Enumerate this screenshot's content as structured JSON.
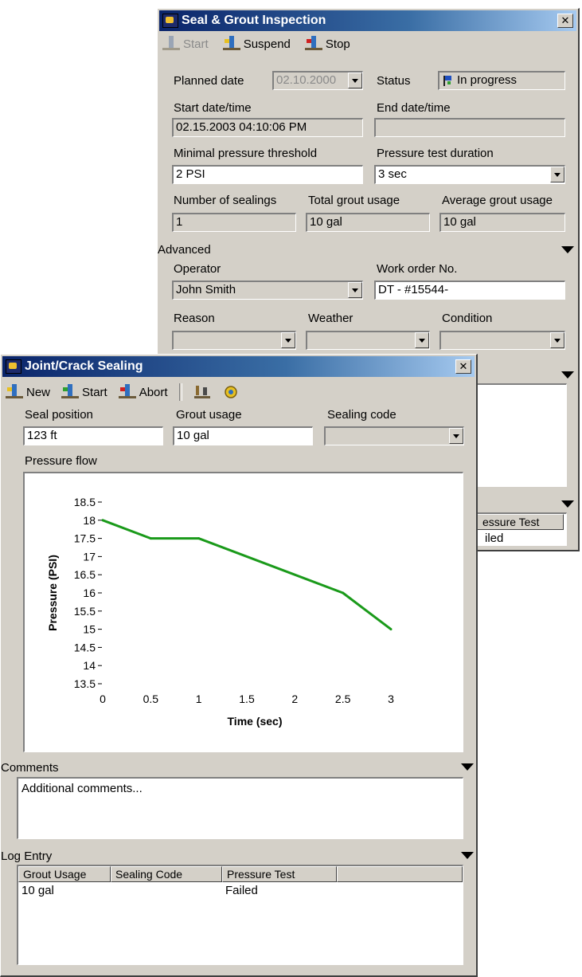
{
  "back_window": {
    "title": "Seal & Grout Inspection",
    "toolbar": {
      "start": "Start",
      "suspend": "Suspend",
      "stop": "Stop"
    },
    "planned_date": {
      "label": "Planned date",
      "value": "02.10.2000"
    },
    "status": {
      "label": "Status",
      "value": "In progress"
    },
    "start_datetime": {
      "label": "Start date/time",
      "value": "02.15.2003 04:10:06 PM"
    },
    "end_datetime": {
      "label": "End date/time",
      "value": ""
    },
    "min_pressure": {
      "label": "Minimal pressure threshold",
      "value": "2 PSI"
    },
    "test_duration": {
      "label": "Pressure test duration",
      "value": "3 sec"
    },
    "num_sealings": {
      "label": "Number of sealings",
      "value": "1"
    },
    "total_grout": {
      "label": "Total grout usage",
      "value": "10 gal"
    },
    "avg_grout": {
      "label": "Average grout usage",
      "value": "10 gal"
    },
    "advanced": {
      "label": "Advanced",
      "operator": {
        "label": "Operator",
        "value": "John Smith"
      },
      "work_order": {
        "label": "Work order No.",
        "value": "DT - #15544-"
      },
      "reason": {
        "label": "Reason",
        "value": ""
      },
      "weather": {
        "label": "Weather",
        "value": ""
      },
      "condition": {
        "label": "Condition",
        "value": ""
      }
    },
    "log_partial": {
      "col": "essure Test",
      "cell": "iled"
    }
  },
  "front_window": {
    "title": "Joint/Crack Sealing",
    "toolbar": {
      "new": "New",
      "start": "Start",
      "abort": "Abort"
    },
    "seal_position": {
      "label": "Seal position",
      "value": "123 ft"
    },
    "grout_usage": {
      "label": "Grout usage",
      "value": "10 gal"
    },
    "sealing_code": {
      "label": "Sealing code",
      "value": ""
    },
    "pressure_flow": {
      "label": "Pressure flow"
    },
    "comments": {
      "label": "Comments",
      "value": "Additional comments..."
    },
    "log": {
      "label": "Log Entry",
      "columns": [
        "Grout Usage",
        "Sealing Code",
        "Pressure Test"
      ],
      "rows": [
        [
          "10 gal",
          "",
          "Failed"
        ]
      ]
    }
  },
  "chart_data": {
    "type": "line",
    "title": "",
    "xlabel": "Time (sec)",
    "ylabel": "Pressure (PSI)",
    "xlim": [
      0,
      3
    ],
    "ylim": [
      13.5,
      18.5
    ],
    "xticks": [
      "0",
      "0.5",
      "1",
      "1.5",
      "2",
      "2.5",
      "3"
    ],
    "yticks": [
      "13.5",
      "14",
      "14.5",
      "15",
      "15.5",
      "16",
      "16.5",
      "17",
      "17.5",
      "18",
      "18.5"
    ],
    "grid": false,
    "series": [
      {
        "color": "#1a9a1a",
        "x": [
          0,
          0.5,
          1,
          2.5,
          3
        ],
        "y": [
          18,
          17.5,
          17.5,
          16,
          15
        ]
      }
    ]
  }
}
